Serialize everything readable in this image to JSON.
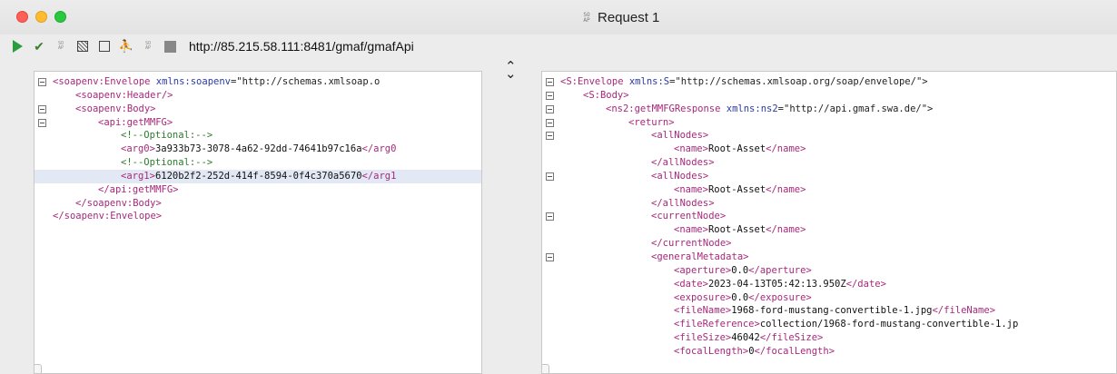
{
  "window": {
    "title": "Request 1",
    "badge": "SO\nAP"
  },
  "toolbar": {
    "endpoint": "http://85.215.58.111:8481/gmaf/gmafApi",
    "mini_badge": "SO\nAP"
  },
  "request": {
    "lines": [
      {
        "fold": true,
        "hl": false,
        "indent": 0,
        "parts": [
          {
            "c": "tag",
            "t": "<soapenv:Envelope "
          },
          {
            "c": "attr",
            "t": "xmlns:soapenv"
          },
          {
            "c": "aval",
            "t": "=\"http://schemas.xmlsoap.o"
          }
        ]
      },
      {
        "fold": false,
        "hl": false,
        "indent": 1,
        "parts": [
          {
            "c": "tag",
            "t": "<soapenv:Header/>"
          }
        ]
      },
      {
        "fold": true,
        "hl": false,
        "indent": 1,
        "parts": [
          {
            "c": "tag",
            "t": "<soapenv:Body>"
          }
        ]
      },
      {
        "fold": true,
        "hl": false,
        "indent": 2,
        "parts": [
          {
            "c": "tag",
            "t": "<api:getMMFG>"
          }
        ]
      },
      {
        "fold": false,
        "hl": false,
        "indent": 3,
        "parts": [
          {
            "c": "cmt",
            "t": "<!--Optional:-->"
          }
        ]
      },
      {
        "fold": false,
        "hl": false,
        "indent": 3,
        "parts": [
          {
            "c": "tag",
            "t": "<arg0>"
          },
          {
            "c": "val",
            "t": "3a933b73-3078-4a62-92dd-74641b97c16a"
          },
          {
            "c": "tag",
            "t": "</arg0"
          }
        ]
      },
      {
        "fold": false,
        "hl": false,
        "indent": 3,
        "parts": [
          {
            "c": "cmt",
            "t": "<!--Optional:-->"
          }
        ]
      },
      {
        "fold": false,
        "hl": true,
        "indent": 3,
        "parts": [
          {
            "c": "tag",
            "t": "<arg1>"
          },
          {
            "c": "val",
            "t": "6120b2f2-252d-414f-8594-0f4c370a5670"
          },
          {
            "c": "tag",
            "t": "</arg1"
          }
        ]
      },
      {
        "fold": false,
        "hl": false,
        "indent": 2,
        "parts": [
          {
            "c": "tag",
            "t": "</api:getMMFG>"
          }
        ]
      },
      {
        "fold": false,
        "hl": false,
        "indent": 1,
        "parts": [
          {
            "c": "tag",
            "t": "</soapenv:Body>"
          }
        ]
      },
      {
        "fold": false,
        "hl": false,
        "indent": 0,
        "parts": [
          {
            "c": "tag",
            "t": "</soapenv:Envelope>"
          }
        ]
      }
    ]
  },
  "response": {
    "lines": [
      {
        "fold": true,
        "hl": false,
        "indent": 0,
        "parts": [
          {
            "c": "tag",
            "t": "<S:Envelope "
          },
          {
            "c": "attr",
            "t": "xmlns:S"
          },
          {
            "c": "aval",
            "t": "=\"http://schemas.xmlsoap.org/soap/envelope/\">"
          }
        ]
      },
      {
        "fold": true,
        "hl": false,
        "indent": 1,
        "parts": [
          {
            "c": "tag",
            "t": "<S:Body>"
          }
        ]
      },
      {
        "fold": true,
        "hl": false,
        "indent": 2,
        "parts": [
          {
            "c": "tag",
            "t": "<ns2:getMMFGResponse "
          },
          {
            "c": "attr",
            "t": "xmlns:ns2"
          },
          {
            "c": "aval",
            "t": "=\"http://api.gmaf.swa.de/\">"
          }
        ]
      },
      {
        "fold": true,
        "hl": false,
        "indent": 3,
        "parts": [
          {
            "c": "tag",
            "t": "<return>"
          }
        ]
      },
      {
        "fold": true,
        "hl": false,
        "indent": 4,
        "parts": [
          {
            "c": "tag",
            "t": "<allNodes>"
          }
        ]
      },
      {
        "fold": false,
        "hl": false,
        "indent": 5,
        "parts": [
          {
            "c": "tag",
            "t": "<name>"
          },
          {
            "c": "val",
            "t": "Root-Asset"
          },
          {
            "c": "tag",
            "t": "</name>"
          }
        ]
      },
      {
        "fold": false,
        "hl": false,
        "indent": 4,
        "parts": [
          {
            "c": "tag",
            "t": "</allNodes>"
          }
        ]
      },
      {
        "fold": true,
        "hl": false,
        "indent": 4,
        "parts": [
          {
            "c": "tag",
            "t": "<allNodes>"
          }
        ]
      },
      {
        "fold": false,
        "hl": false,
        "indent": 5,
        "parts": [
          {
            "c": "tag",
            "t": "<name>"
          },
          {
            "c": "val",
            "t": "Root-Asset"
          },
          {
            "c": "tag",
            "t": "</name>"
          }
        ]
      },
      {
        "fold": false,
        "hl": false,
        "indent": 4,
        "parts": [
          {
            "c": "tag",
            "t": "</allNodes>"
          }
        ]
      },
      {
        "fold": true,
        "hl": false,
        "indent": 4,
        "parts": [
          {
            "c": "tag",
            "t": "<currentNode>"
          }
        ]
      },
      {
        "fold": false,
        "hl": false,
        "indent": 5,
        "parts": [
          {
            "c": "tag",
            "t": "<name>"
          },
          {
            "c": "val",
            "t": "Root-Asset"
          },
          {
            "c": "tag",
            "t": "</name>"
          }
        ]
      },
      {
        "fold": false,
        "hl": false,
        "indent": 4,
        "parts": [
          {
            "c": "tag",
            "t": "</currentNode>"
          }
        ]
      },
      {
        "fold": true,
        "hl": false,
        "indent": 4,
        "parts": [
          {
            "c": "tag",
            "t": "<generalMetadata>"
          }
        ]
      },
      {
        "fold": false,
        "hl": false,
        "indent": 5,
        "parts": [
          {
            "c": "tag",
            "t": "<aperture>"
          },
          {
            "c": "val",
            "t": "0.0"
          },
          {
            "c": "tag",
            "t": "</aperture>"
          }
        ]
      },
      {
        "fold": false,
        "hl": false,
        "indent": 5,
        "parts": [
          {
            "c": "tag",
            "t": "<date>"
          },
          {
            "c": "val",
            "t": "2023-04-13T05:42:13.950Z"
          },
          {
            "c": "tag",
            "t": "</date>"
          }
        ]
      },
      {
        "fold": false,
        "hl": false,
        "indent": 5,
        "parts": [
          {
            "c": "tag",
            "t": "<exposure>"
          },
          {
            "c": "val",
            "t": "0.0"
          },
          {
            "c": "tag",
            "t": "</exposure>"
          }
        ]
      },
      {
        "fold": false,
        "hl": false,
        "indent": 5,
        "parts": [
          {
            "c": "tag",
            "t": "<fileName>"
          },
          {
            "c": "val",
            "t": "1968-ford-mustang-convertible-1.jpg"
          },
          {
            "c": "tag",
            "t": "</fileName>"
          }
        ]
      },
      {
        "fold": false,
        "hl": false,
        "indent": 5,
        "parts": [
          {
            "c": "tag",
            "t": "<fileReference>"
          },
          {
            "c": "val",
            "t": "collection/1968-ford-mustang-convertible-1.jp"
          }
        ]
      },
      {
        "fold": false,
        "hl": false,
        "indent": 5,
        "parts": [
          {
            "c": "tag",
            "t": "<fileSize>"
          },
          {
            "c": "val",
            "t": "46042"
          },
          {
            "c": "tag",
            "t": "</fileSize>"
          }
        ]
      },
      {
        "fold": false,
        "hl": false,
        "indent": 5,
        "parts": [
          {
            "c": "tag",
            "t": "<focalLength>"
          },
          {
            "c": "val",
            "t": "0"
          },
          {
            "c": "tag",
            "t": "</focalLength>"
          }
        ]
      }
    ]
  },
  "colors": {
    "tag": "#a8287a",
    "attr": "#2a3aa8",
    "comment": "#2c7a2c",
    "highlight": "#e2e9f5"
  }
}
